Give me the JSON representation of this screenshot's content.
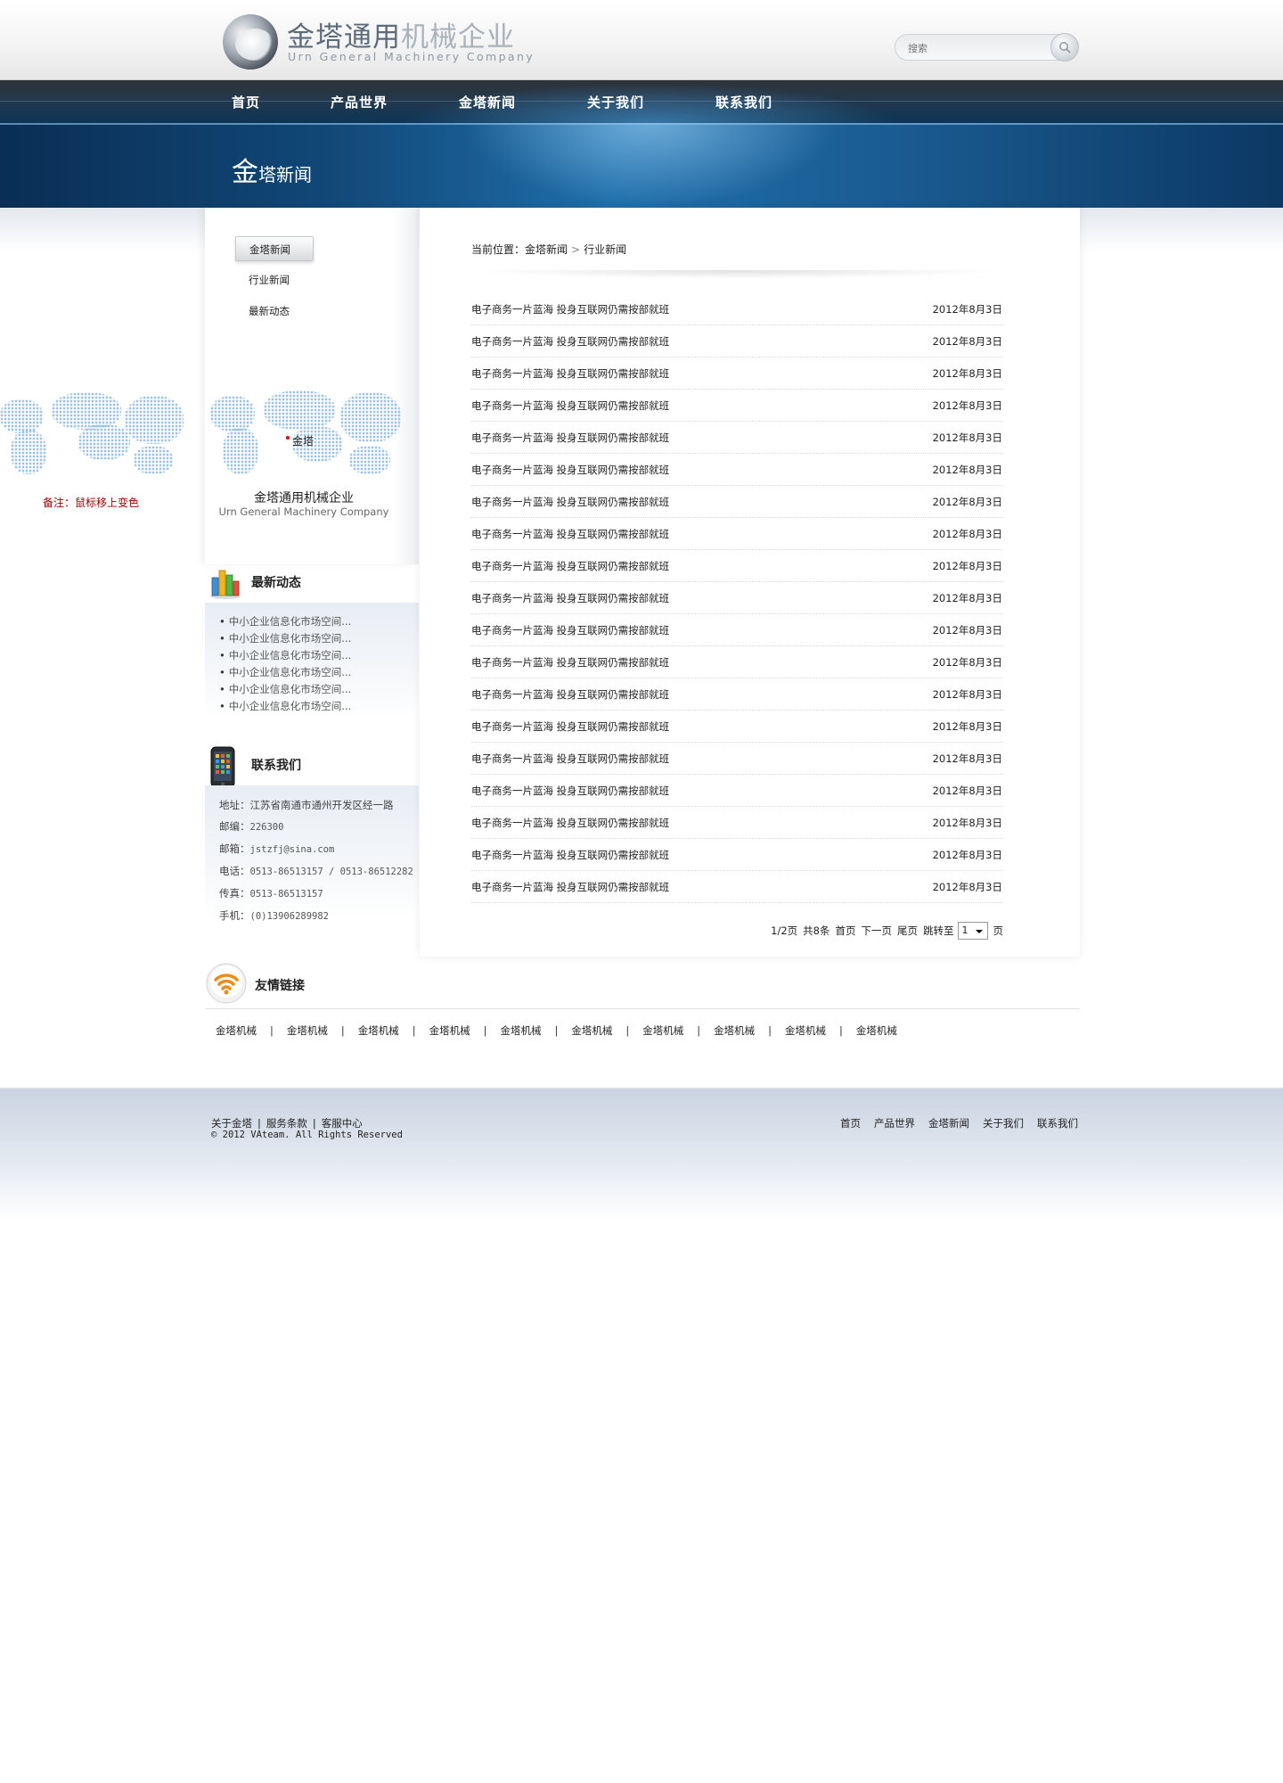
{
  "header": {
    "logo_cn_dark": "金塔通用",
    "logo_cn_light": "机械企业",
    "logo_en": "Urn General Machinery Company",
    "search_placeholder": "搜索"
  },
  "nav": {
    "items": [
      {
        "label": "首页"
      },
      {
        "label": "产品世界"
      },
      {
        "label": "金塔新闻"
      },
      {
        "label": "关于我们"
      },
      {
        "label": "联系我们"
      }
    ]
  },
  "banner": {
    "title_big": "金",
    "title_rest": "塔新闻"
  },
  "sidebar": {
    "subnav": [
      {
        "label": "金塔新闻",
        "active": true
      },
      {
        "label": "行业新闻",
        "active": false
      },
      {
        "label": "最新动态",
        "active": false
      }
    ],
    "map_city": "金塔",
    "company_cn": "金塔通用机械企业",
    "company_en": "Urn General Machinery Company",
    "news_title": "最新动态",
    "news_items": [
      "中小企业信息化市场空间...",
      "中小企业信息化市场空间...",
      "中小企业信息化市场空间...",
      "中小企业信息化市场空间...",
      "中小企业信息化市场空间...",
      "中小企业信息化市场空间..."
    ],
    "contact_title": "联系我们",
    "contact": {
      "address_label": "地址：",
      "address": "江苏省南通市通州开发区经一路",
      "zip_label": "邮编：",
      "zip": "226300",
      "email_label": "邮箱：",
      "email": "jstzfj@sina.com",
      "phone_label": "电话：",
      "phone": "0513-86513157 / 0513-86512282",
      "fax_label": "传真：",
      "fax": "0513-86513157",
      "mobile_label": "手机：",
      "mobile": "(0)13906289982"
    }
  },
  "left_note": "备注：鼠标移上变色",
  "main": {
    "breadcrumb_prefix": "当前位置：",
    "breadcrumb_parent": "金塔新闻",
    "breadcrumb_current": "行业新闻",
    "rows": [
      {
        "title": "电子商务一片蓝海 投身互联网仍需按部就班",
        "date": "2012年8月3日"
      },
      {
        "title": "电子商务一片蓝海 投身互联网仍需按部就班",
        "date": "2012年8月3日"
      },
      {
        "title": "电子商务一片蓝海 投身互联网仍需按部就班",
        "date": "2012年8月3日"
      },
      {
        "title": "电子商务一片蓝海 投身互联网仍需按部就班",
        "date": "2012年8月3日"
      },
      {
        "title": "电子商务一片蓝海 投身互联网仍需按部就班",
        "date": "2012年8月3日"
      },
      {
        "title": "电子商务一片蓝海 投身互联网仍需按部就班",
        "date": "2012年8月3日"
      },
      {
        "title": "电子商务一片蓝海 投身互联网仍需按部就班",
        "date": "2012年8月3日"
      },
      {
        "title": "电子商务一片蓝海 投身互联网仍需按部就班",
        "date": "2012年8月3日"
      },
      {
        "title": "电子商务一片蓝海 投身互联网仍需按部就班",
        "date": "2012年8月3日"
      },
      {
        "title": "电子商务一片蓝海 投身互联网仍需按部就班",
        "date": "2012年8月3日"
      },
      {
        "title": "电子商务一片蓝海 投身互联网仍需按部就班",
        "date": "2012年8月3日"
      },
      {
        "title": "电子商务一片蓝海 投身互联网仍需按部就班",
        "date": "2012年8月3日"
      },
      {
        "title": "电子商务一片蓝海 投身互联网仍需按部就班",
        "date": "2012年8月3日"
      },
      {
        "title": "电子商务一片蓝海 投身互联网仍需按部就班",
        "date": "2012年8月3日"
      },
      {
        "title": "电子商务一片蓝海 投身互联网仍需按部就班",
        "date": "2012年8月3日"
      },
      {
        "title": "电子商务一片蓝海 投身互联网仍需按部就班",
        "date": "2012年8月3日"
      },
      {
        "title": "电子商务一片蓝海 投身互联网仍需按部就班",
        "date": "2012年8月3日"
      },
      {
        "title": "电子商务一片蓝海 投身互联网仍需按部就班",
        "date": "2012年8月3日"
      },
      {
        "title": "电子商务一片蓝海 投身互联网仍需按部就班",
        "date": "2012年8月3日"
      }
    ],
    "pager": {
      "page_info": "1/2页",
      "total": "共8条",
      "first": "首页",
      "next": "下一页",
      "last": "尾页",
      "jump": "跳转至",
      "selected": "1",
      "suffix": "页"
    }
  },
  "friends": {
    "title": "友情链接",
    "links": [
      "金塔机械",
      "金塔机械",
      "金塔机械",
      "金塔机械",
      "金塔机械",
      "金塔机械",
      "金塔机械",
      "金塔机械",
      "金塔机械",
      "金塔机械"
    ],
    "separator": "|"
  },
  "footer": {
    "links": [
      "关于金塔",
      "服务条款",
      "客服中心"
    ],
    "separator": "|",
    "copyright": "© 2012 VAteam. All Rights Reserved",
    "nav": [
      "首页",
      "产品世界",
      "金塔新闻",
      "关于我们",
      "联系我们"
    ]
  },
  "colors": {
    "nav_bg": "#23384c",
    "banner_accent": "#1f6fab",
    "note_red": "#a00000",
    "map_dot": "#9ec3e4"
  }
}
